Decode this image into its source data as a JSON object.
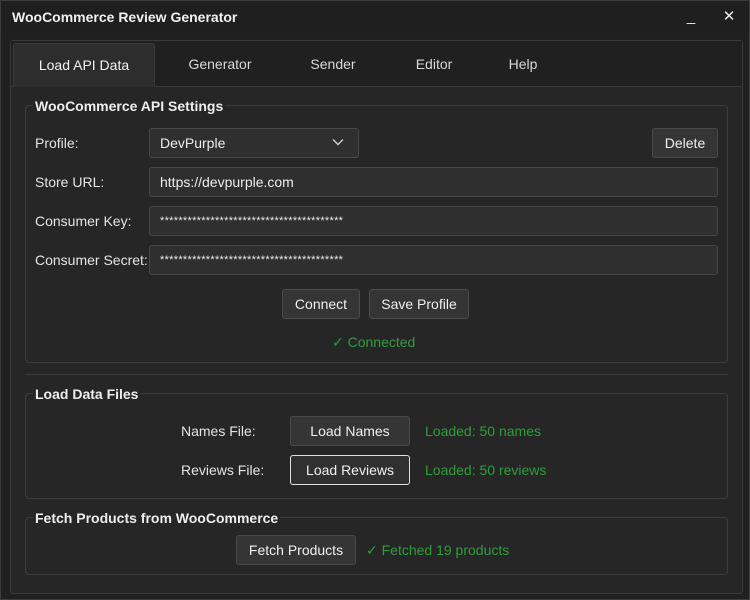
{
  "window": {
    "title": "WooCommerce Review Generator",
    "minimize_glyph": "_",
    "close_glyph": "✕"
  },
  "tabs": [
    {
      "label": "Load API Data",
      "active": true
    },
    {
      "label": "Generator"
    },
    {
      "label": "Sender"
    },
    {
      "label": "Editor"
    },
    {
      "label": "Help"
    }
  ],
  "api_settings": {
    "title": "WooCommerce API Settings",
    "profile_label": "Profile:",
    "profile_value": "DevPurple",
    "delete_label": "Delete",
    "store_url_label": "Store URL:",
    "store_url_value": "https://devpurple.com",
    "consumer_key_label": "Consumer Key:",
    "consumer_key_value": "****************************************",
    "consumer_secret_label": "Consumer Secret:",
    "consumer_secret_value": "****************************************",
    "connect_label": "Connect",
    "save_profile_label": "Save Profile",
    "status_text": "✓ Connected"
  },
  "data_files": {
    "title": "Load Data Files",
    "names_label": "Names File:",
    "load_names_label": "Load Names",
    "names_status": "Loaded: 50 names",
    "reviews_label": "Reviews File:",
    "load_reviews_label": "Load Reviews",
    "reviews_status": "Loaded: 50 reviews"
  },
  "fetch_products": {
    "title": "Fetch Products from WooCommerce",
    "fetch_label": "Fetch Products",
    "status_text": "✓ Fetched 19 products"
  },
  "colors": {
    "success": "#2e9e3a",
    "background": "#202020",
    "panel": "#262626"
  }
}
